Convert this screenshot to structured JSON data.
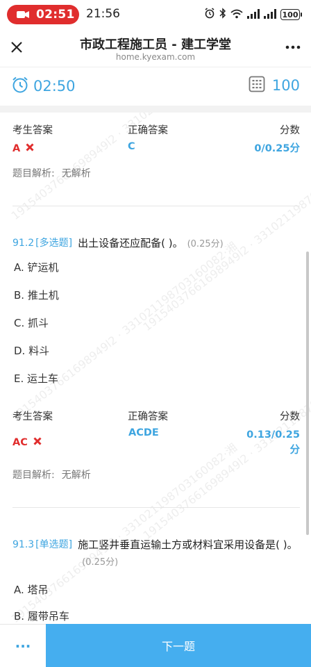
{
  "status_bar": {
    "recording_time": "02:51",
    "clock": "21:56",
    "battery": "100",
    "icons": [
      "video-camera-icon",
      "alarm-icon",
      "bluetooth-icon",
      "wifi-icon",
      "signal-icon",
      "signal-icon",
      "battery-icon"
    ]
  },
  "navbar": {
    "title": "市政工程施工员 - 建工学堂",
    "url": "home.kyexam.com",
    "icons": [
      "close-icon",
      "more-icon"
    ]
  },
  "exam_bar": {
    "timer": "02:50",
    "question_count": "100",
    "icons": [
      "alarm-clock-icon",
      "answer-sheet-icon"
    ]
  },
  "watermark_text": "19154037661698949l2 · 3310211987031600​82·湘",
  "prev_answer": {
    "mine_label": "考生答案",
    "correct_label": "正确答案",
    "score_label": "分数",
    "mine_value": "A",
    "correct_value": "C",
    "score_value": "0/0.25分",
    "analysis_label": "题目解析:",
    "analysis_value": "无解析"
  },
  "question_2": {
    "number": "91.2",
    "type": "[多选题]",
    "text": "出土设备还应配备( )。",
    "points": "(0.25分)",
    "options": [
      "A. 铲运机",
      "B. 推土机",
      "C. 抓斗",
      "D. 料斗",
      "E. 运土车"
    ],
    "answer": {
      "mine_label": "考生答案",
      "correct_label": "正确答案",
      "score_label": "分数",
      "mine_value": "AC",
      "correct_value": "ACDE",
      "score_value": "0.13/0.25分",
      "analysis_label": "题目解析:",
      "analysis_value": "无解析"
    }
  },
  "question_3": {
    "number": "91.3",
    "type": "[单选题]",
    "text": "施工竖井垂直运输土方或材料宜采用设备是( )。",
    "points": "(0.25分)",
    "options": [
      "A. 塔吊",
      "B. 履带吊车"
    ]
  },
  "bottom_bar": {
    "more_label": "···",
    "next_label": "下一题"
  },
  "colors": {
    "accent": "#3ea5e0",
    "wrong": "#e02d2d",
    "next_button": "#45aeef",
    "record_pill": "#e02d2d"
  }
}
